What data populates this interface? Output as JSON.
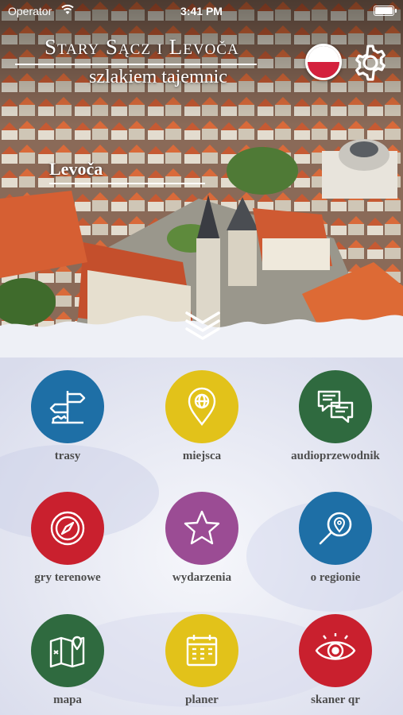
{
  "status_bar": {
    "carrier": "Operator",
    "time": "3:41 PM"
  },
  "header": {
    "title": "Stary Sącz i Levoča",
    "subtitle": "szlakiem tajemnic",
    "language_flag": "poland-flag-icon",
    "settings_icon": "gear-icon"
  },
  "hero": {
    "location": "Levoča",
    "scroll_icon": "double-chevron-down-icon"
  },
  "menu": {
    "items": [
      {
        "label": "trasy",
        "icon": "signpost-icon",
        "color": "#1e6fa6"
      },
      {
        "label": "miejsca",
        "icon": "map-pin-icon",
        "color": "#e2c21a"
      },
      {
        "label": "audioprzewodnik",
        "icon": "chat-bubbles-icon",
        "color": "#2f6a3f"
      },
      {
        "label": "gry terenowe",
        "icon": "compass-icon",
        "color": "#c9202e"
      },
      {
        "label": "wydarzenia",
        "icon": "star-icon",
        "color": "#9b4c94"
      },
      {
        "label": "o regionie",
        "icon": "magnifier-pin-icon",
        "color": "#1e6fa6"
      },
      {
        "label": "mapa",
        "icon": "folded-map-icon",
        "color": "#2f6a3f"
      },
      {
        "label": "planer",
        "icon": "calendar-icon",
        "color": "#e2c21a"
      },
      {
        "label": "skaner qr",
        "icon": "eye-icon",
        "color": "#c9202e"
      }
    ]
  }
}
